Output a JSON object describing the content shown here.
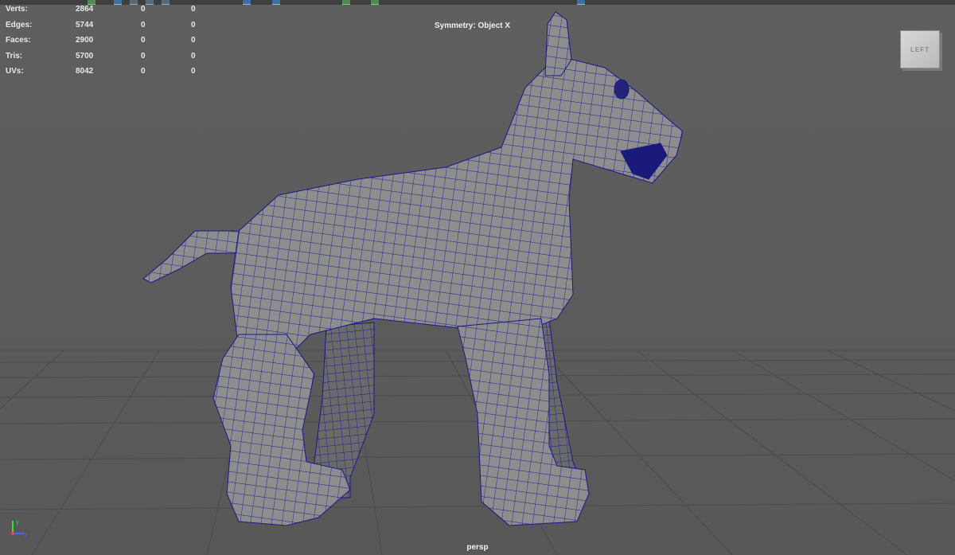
{
  "stats": {
    "rows": [
      {
        "label": "Verts:",
        "total": "2864",
        "selected": "0",
        "component": "0"
      },
      {
        "label": "Edges:",
        "total": "5744",
        "selected": "0",
        "component": "0"
      },
      {
        "label": "Faces:",
        "total": "2900",
        "selected": "0",
        "component": "0"
      },
      {
        "label": "Tris:",
        "total": "5700",
        "selected": "0",
        "component": "0"
      },
      {
        "label": "UVs:",
        "total": "8042",
        "selected": "0",
        "component": "0"
      }
    ]
  },
  "viewport": {
    "symmetry_label": "Symmetry: Object X",
    "viewcube_face": "LEFT",
    "camera_name": "persp"
  },
  "icons": [
    "toolbar-icon",
    "axis-gizmo-icon",
    "viewcube-icon"
  ],
  "colors": {
    "background": "#5d5d5d",
    "wireframe": "#1a1a8c",
    "mesh_fill": "#8a8a8a",
    "grid": "#4a4a4a",
    "hud_text": "#e8e8e8"
  }
}
